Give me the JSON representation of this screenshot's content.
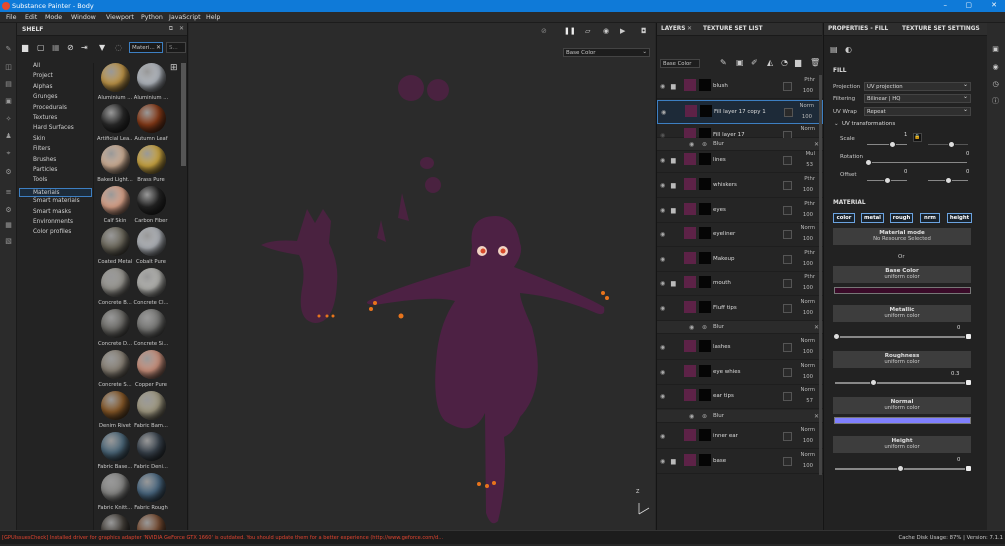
{
  "window": {
    "title": "Substance Painter - Body"
  },
  "menu": [
    "File",
    "Edit",
    "Mode",
    "Window",
    "Viewport",
    "Python",
    "JavaScript",
    "Help"
  ],
  "shelf": {
    "title": "SHELF",
    "search_value": "Materi...",
    "search_value2": "S...",
    "categories": [
      "All",
      "Project",
      "Alphas",
      "Grunges",
      "Procedurals",
      "Textures",
      "Hard Surfaces",
      "Skin",
      "Filters",
      "Brushes",
      "Particles",
      "Tools",
      "Materials",
      "Smart materials",
      "Smart masks",
      "Environments",
      "Color profiles"
    ],
    "selected_category": "Materials",
    "materials": [
      {
        "name": "Aluminium ...",
        "color": "#c59a4a"
      },
      {
        "name": "Aluminium ...",
        "color": "#b8bec6"
      },
      {
        "name": "Artificial Lea...",
        "color": "#2b2b2b"
      },
      {
        "name": "Autumn Leaf",
        "color": "#8a3b17"
      },
      {
        "name": "Baked Light...",
        "color": "#d6b59a"
      },
      {
        "name": "Brass Pure",
        "color": "#d2ab43"
      },
      {
        "name": "Calf Skin",
        "color": "#e3a98e"
      },
      {
        "name": "Carbon Fiber",
        "color": "#262626"
      },
      {
        "name": "Coated Metal",
        "color": "#6f6b5e"
      },
      {
        "name": "Cobalt Pure",
        "color": "#b5b9bf"
      },
      {
        "name": "Concrete B...",
        "color": "#9c9a94"
      },
      {
        "name": "Concrete Cl...",
        "color": "#b8b8b4"
      },
      {
        "name": "Concrete D...",
        "color": "#6f6e6a"
      },
      {
        "name": "Concrete Si...",
        "color": "#7a7a78"
      },
      {
        "name": "Concrete S...",
        "color": "#8c8478"
      },
      {
        "name": "Copper Pure",
        "color": "#d19580"
      },
      {
        "name": "Denim Rivet",
        "color": "#8a5a28"
      },
      {
        "name": "Fabric Bam...",
        "color": "#a69f86"
      },
      {
        "name": "Fabric Base...",
        "color": "#4d6a7d"
      },
      {
        "name": "Fabric Deni...",
        "color": "#3b4550"
      },
      {
        "name": "Fabric Knitt...",
        "color": "#8a8a88"
      },
      {
        "name": "Fabric Rough",
        "color": "#4b6a84"
      },
      {
        "name": "",
        "color": "#46413b"
      },
      {
        "name": "",
        "color": "#7a4e33"
      }
    ]
  },
  "viewport": {
    "channel": "Base Color",
    "axis": "Z"
  },
  "layers": {
    "tabs": [
      "LAYERS",
      "TEXTURE SET LIST"
    ],
    "channel": "Base Color",
    "rows": [
      {
        "name": "blush",
        "blend": "Pthr",
        "opacity": "100",
        "folder": true
      },
      {
        "name": "Fill layer 17 copy 1",
        "blend": "Norm",
        "opacity": "100",
        "selected": true
      },
      {
        "name": "Fill layer 17",
        "blend": "Norm",
        "opacity": "",
        "hidden": true
      },
      {
        "name": "lines",
        "blend": "Mul",
        "opacity": "53",
        "folder": true
      },
      {
        "name": "whiskers",
        "blend": "Pthr",
        "opacity": "100",
        "folder": true
      },
      {
        "name": "eyes",
        "blend": "Pthr",
        "opacity": "100",
        "folder": true
      },
      {
        "name": "eyeliner",
        "blend": "Norm",
        "opacity": "100"
      },
      {
        "name": "Makeup",
        "blend": "Pthr",
        "opacity": "100"
      },
      {
        "name": "mouth",
        "blend": "Pthr",
        "opacity": "100",
        "folder": true
      },
      {
        "name": "Fluff tips",
        "blend": "Norm",
        "opacity": "100"
      },
      {
        "name": "lashes",
        "blend": "Norm",
        "opacity": "100"
      },
      {
        "name": "eye whies",
        "blend": "Norm",
        "opacity": "100"
      },
      {
        "name": "ear tips",
        "blend": "Norm",
        "opacity": "57"
      },
      {
        "name": "inner ear",
        "blend": "Norm",
        "opacity": "100"
      },
      {
        "name": "base",
        "blend": "Norm",
        "opacity": "100",
        "folder": true
      }
    ],
    "blur_label": "Blur"
  },
  "properties": {
    "tabs": [
      "PROPERTIES - FILL",
      "TEXTURE SET SETTINGS"
    ],
    "fill_title": "FILL",
    "projection_label": "Projection",
    "projection_value": "UV projection",
    "filtering_label": "Filtering",
    "filtering_value": "Bilinear | HQ",
    "uvwrap_label": "UV Wrap",
    "uvwrap_value": "Repeat",
    "uv_title": "UV transformations",
    "scale_label": "Scale",
    "scale_val": "1",
    "rotation_label": "Rotation",
    "rotation_val": "0",
    "offset_label": "Offset",
    "offset_val1": "0",
    "offset_val2": "0",
    "material_title": "MATERIAL",
    "channels": [
      "color",
      "metal",
      "rough",
      "nrm",
      "height"
    ],
    "mode_label": "Material mode",
    "mode_value": "No Resource Selected",
    "or": "Or",
    "basecolor_label": "Base Color",
    "basecolor_sub": "uniform color",
    "basecolor_swatch": "#3a0a28",
    "metallic_label": "Metallic",
    "metallic_sub": "uniform color",
    "metallic_val": "0",
    "roughness_label": "Roughness",
    "roughness_sub": "uniform color",
    "roughness_val": "0.3",
    "normal_label": "Normal",
    "normal_sub": "uniform color",
    "normal_swatch": "#8080ff",
    "height_label": "Height",
    "height_sub": "uniform color",
    "height_val": "0"
  },
  "status": {
    "message": "[GPUIssuesCheck] Installed driver for graphics adapter 'NVIDIA GeForce GTX 1660' is outdated. You should update them for a better experience (http://www.geforce.com/d...",
    "cache": "Cache Disk Usage:   87%  |  Version: 7.1.1"
  }
}
